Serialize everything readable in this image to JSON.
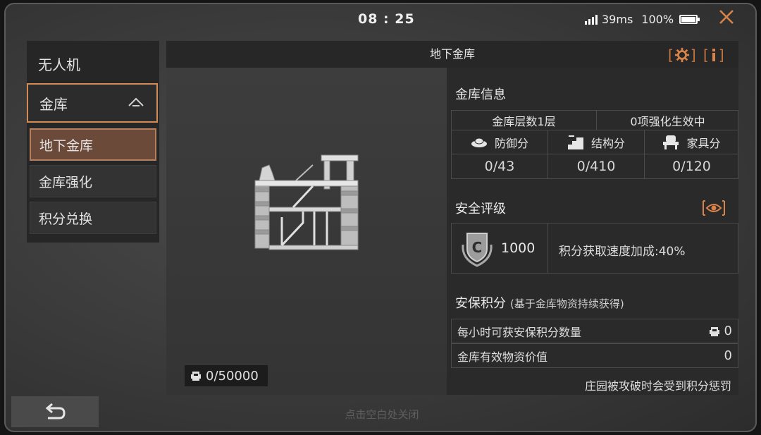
{
  "status": {
    "clock": "08 : 25",
    "ping": "39ms",
    "battery": "100%",
    "close_icon": "close-icon"
  },
  "menu": {
    "drone": "无人机",
    "vault": "金库",
    "sub_items": [
      "地下金库",
      "金库强化",
      "积分兑换"
    ],
    "selected": "地下金库"
  },
  "panel": {
    "title": "地下金库",
    "capacity": "0/50000"
  },
  "vault_info": {
    "title": "金库信息",
    "floors": "金库层数1层",
    "buffs": "0项强化生效中",
    "columns": [
      {
        "icon": "defense-icon",
        "label": "防御分",
        "value": "0/43"
      },
      {
        "icon": "structure-icon",
        "label": "结构分",
        "value": "0/410"
      },
      {
        "icon": "furniture-icon",
        "label": "家具分",
        "value": "0/120"
      }
    ]
  },
  "safety": {
    "title": "安全评级",
    "score": "1000",
    "bonus": "积分获取速度加成:40%"
  },
  "security_points": {
    "title": "安保积分",
    "subtitle": "(基于金库物资持续获得)",
    "rows": [
      {
        "label": "每小时可获安保积分数量",
        "value": "0"
      },
      {
        "label": "金库有效物资价值",
        "value": "0"
      }
    ],
    "penalty": "庄园被攻破时会受到积分惩罚"
  },
  "hint": "点击空白处关闭",
  "colors": {
    "accent": "#d7834a",
    "selected_bg": "#6b4a3a",
    "panel_bg": "#2a2a2a"
  }
}
